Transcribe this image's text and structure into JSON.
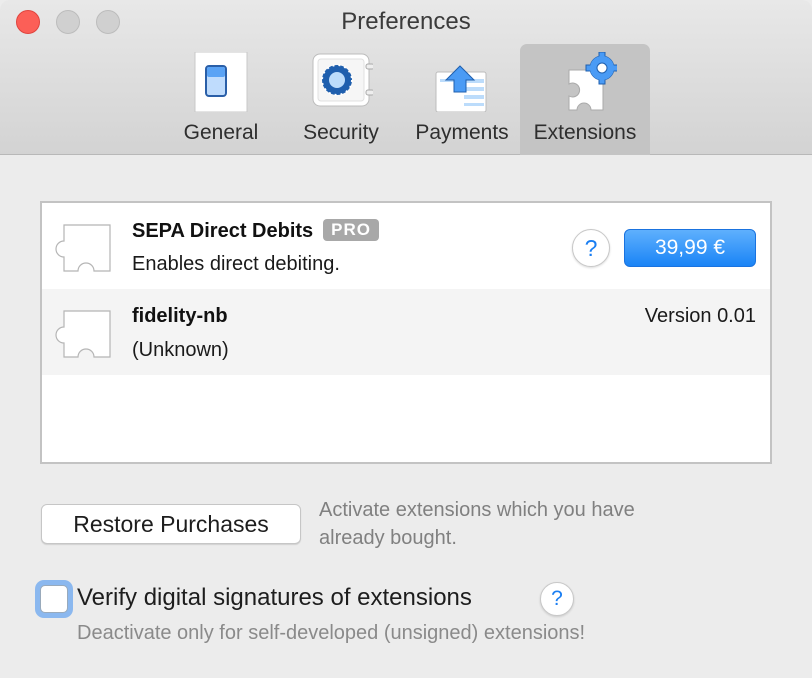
{
  "window": {
    "title": "Preferences"
  },
  "tabs": [
    {
      "id": "general",
      "label": "General",
      "icon": "switch-icon"
    },
    {
      "id": "security",
      "label": "Security",
      "icon": "safe-icon"
    },
    {
      "id": "payments",
      "label": "Payments",
      "icon": "upload-tray-icon"
    },
    {
      "id": "extensions",
      "label": "Extensions",
      "icon": "puzzle-gear-icon",
      "active": true
    }
  ],
  "extensions": [
    {
      "name": "SEPA Direct Debits",
      "badge": "PRO",
      "description": "Enables direct debiting.",
      "help": "?",
      "price": "39,99 €"
    },
    {
      "name": "fidelity-nb",
      "description": "(Unknown)",
      "version": "Version 0.01"
    }
  ],
  "restore": {
    "button_label": "Restore Purchases",
    "hint": "Activate extensions which you have already bought."
  },
  "verify": {
    "label": "Verify digital signatures of extensions",
    "checked": false,
    "help": "?",
    "hint": "Deactivate only for self-developed (unsigned) extensions!"
  },
  "colors": {
    "accent": "#1a84f6",
    "close": "#fc5f57",
    "focus_ring": "#8bb8ef",
    "badge": "#a8a8a8"
  }
}
